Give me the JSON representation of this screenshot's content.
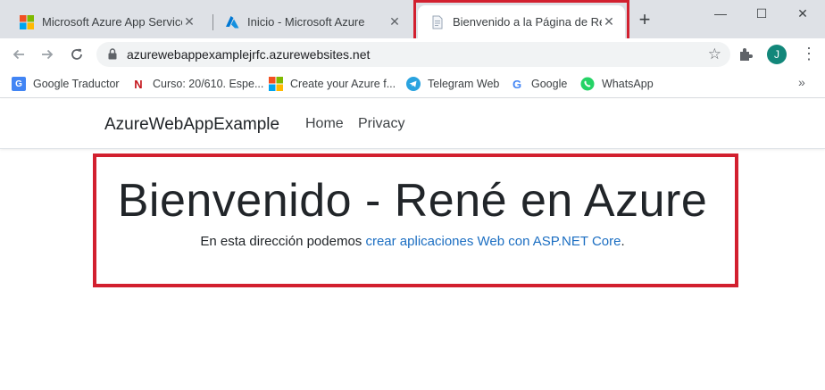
{
  "browser": {
    "tabs": [
      {
        "title": "Microsoft Azure App Service - W",
        "active": false
      },
      {
        "title": "Inicio - Microsoft Azure",
        "active": false
      },
      {
        "title": "Bienvenido a la Página de René",
        "active": true
      }
    ],
    "close_glyph": "✕",
    "new_tab_glyph": "+",
    "window_controls": {
      "minimize": "—",
      "maximize": "☐",
      "close": "✕"
    },
    "url": "azurewebappexamplejrfc.azurewebsites.net",
    "star_glyph": "☆",
    "profile_initial": "J",
    "menu_glyph": "⋮",
    "bookmarks": [
      {
        "label": "Google Traductor",
        "icon": "google-translate-icon"
      },
      {
        "label": "Curso: 20/610. Espe...",
        "icon": "netflix-icon"
      },
      {
        "label": "Create your Azure f...",
        "icon": "microsoft-icon"
      },
      {
        "label": "Telegram Web",
        "icon": "telegram-icon"
      },
      {
        "label": "Google",
        "icon": "google-icon"
      },
      {
        "label": "WhatsApp",
        "icon": "whatsapp-icon"
      }
    ],
    "bookmarks_overflow": "»"
  },
  "page": {
    "brand": "AzureWebAppExample",
    "nav": [
      "Home",
      "Privacy"
    ],
    "hero_title": "Bienvenido - René en Azure",
    "hero_text_prefix": "En esta dirección podemos ",
    "hero_link": "crear aplicaciones Web con ASP.NET Core",
    "hero_text_suffix": "."
  },
  "colors": {
    "highlight": "#d2202f",
    "link": "#1b6ec2",
    "tabstrip": "#dee1e6"
  }
}
